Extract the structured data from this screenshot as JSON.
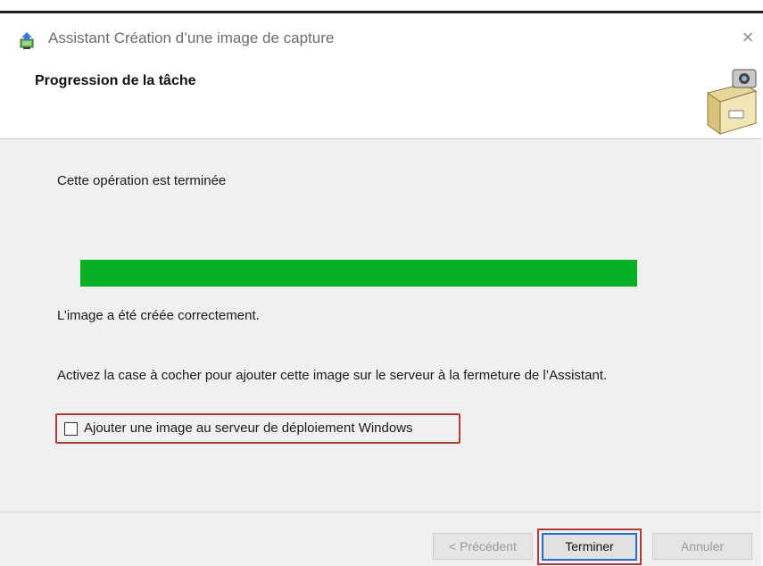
{
  "window": {
    "title": "Assistant Création d’une image de capture",
    "close_glyph": "×",
    "app_icon": "computer-install-icon"
  },
  "header": {
    "title": "Progression de la tâche",
    "icon": "file-cabinet-camera-icon"
  },
  "content": {
    "status": "Cette opération est terminée",
    "progress_fraction": 1.0,
    "progress_color": "#06b025",
    "result": "L’image a été créée correctement.",
    "instruction": "Activez la case à cocher pour ajouter cette image sur le serveur à la fermeture de l’Assistant.",
    "checkbox": {
      "label": "Ajouter une image au serveur de déploiement Windows",
      "checked": false
    }
  },
  "footer": {
    "prev_label": "< Précédent",
    "finish_label": "Terminer",
    "cancel_label": "Annuler"
  },
  "highlight_color": "#b43a3a"
}
